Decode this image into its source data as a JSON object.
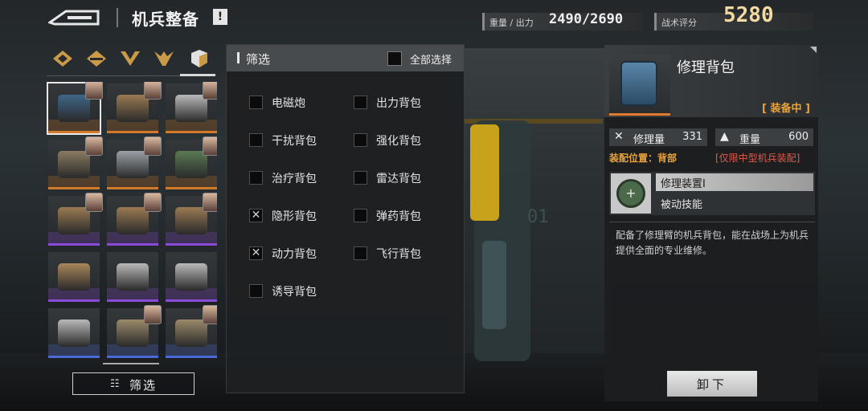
{
  "header": {
    "back_label": "",
    "title": "机兵整备",
    "info_symbol": "!",
    "weight_label": "重量 / 出力",
    "weight_value": "2490/2690",
    "score_label": "战术评分",
    "score_value": "5280"
  },
  "category_tabs": [
    {
      "name": "tab-category-1"
    },
    {
      "name": "tab-category-2"
    },
    {
      "name": "tab-category-3"
    },
    {
      "name": "tab-category-4"
    },
    {
      "name": "tab-category-backpack"
    }
  ],
  "grid_items": [
    {
      "rarity": "#d07a2a",
      "color": "#3f6688",
      "portrait": true,
      "selected": true
    },
    {
      "rarity": "#d07a2a",
      "color": "#9a7a52",
      "portrait": true
    },
    {
      "rarity": "#d07a2a",
      "color": "#b9b9b9",
      "portrait": true
    },
    {
      "rarity": "#d07a2a",
      "color": "#8a7a62",
      "portrait": true
    },
    {
      "rarity": "#d07a2a",
      "color": "#9aa0a6",
      "portrait": true
    },
    {
      "rarity": "#d07a2a",
      "color": "#5a7a54",
      "portrait": true
    },
    {
      "rarity": "#8a4ad8",
      "color": "#9a7a52",
      "portrait": true
    },
    {
      "rarity": "#8a4ad8",
      "color": "#9a7a52",
      "portrait": true
    },
    {
      "rarity": "#8a4ad8",
      "color": "#9a7a52",
      "portrait": true
    },
    {
      "rarity": "#8a4ad8",
      "color": "#a8865a",
      "portrait": false
    },
    {
      "rarity": "#8a4ad8",
      "color": "#b9b9b9",
      "portrait": false
    },
    {
      "rarity": "#8a4ad8",
      "color": "#b9b9b9",
      "portrait": false
    },
    {
      "rarity": "#4a6ad8",
      "color": "#b9b9b9",
      "portrait": false
    },
    {
      "rarity": "#4a6ad8",
      "color": "#9a8a6a",
      "portrait": true
    },
    {
      "rarity": "#4a6ad8",
      "color": "#9a8a6a",
      "portrait": true
    }
  ],
  "filter_button": {
    "label": "筛选"
  },
  "filter_panel": {
    "title": "筛选",
    "select_all": "全部选择",
    "options_left": [
      {
        "label": "电磁炮",
        "checked": false
      },
      {
        "label": "干扰背包",
        "checked": false
      },
      {
        "label": "治疗背包",
        "checked": false
      },
      {
        "label": "隐形背包",
        "checked": true
      },
      {
        "label": "动力背包",
        "checked": true
      },
      {
        "label": "诱导背包",
        "checked": false
      }
    ],
    "options_right": [
      {
        "label": "出力背包",
        "checked": false
      },
      {
        "label": "强化背包",
        "checked": false
      },
      {
        "label": "雷达背包",
        "checked": false
      },
      {
        "label": "弹药背包",
        "checked": false
      },
      {
        "label": "飞行背包",
        "checked": false
      }
    ]
  },
  "detail": {
    "name": "修理背包",
    "status": "[ 装备中 ]",
    "stat1_icon": "✕",
    "stat1_label": "修理量",
    "stat1_value": "331",
    "stat2_icon": "▲",
    "stat2_label": "重量",
    "stat2_value": "600",
    "position": "装配位置：背部",
    "restriction": "[仅限中型机兵装配]",
    "skill_name": "修理装置Ⅰ",
    "skill_type": "被动技能",
    "skill_symbol": "+",
    "description": "配备了修理臂的机兵背包，能在战场上为机兵提供全面的专业维修。",
    "unequip_label": "卸下"
  },
  "background": {
    "floor_number": "01"
  }
}
